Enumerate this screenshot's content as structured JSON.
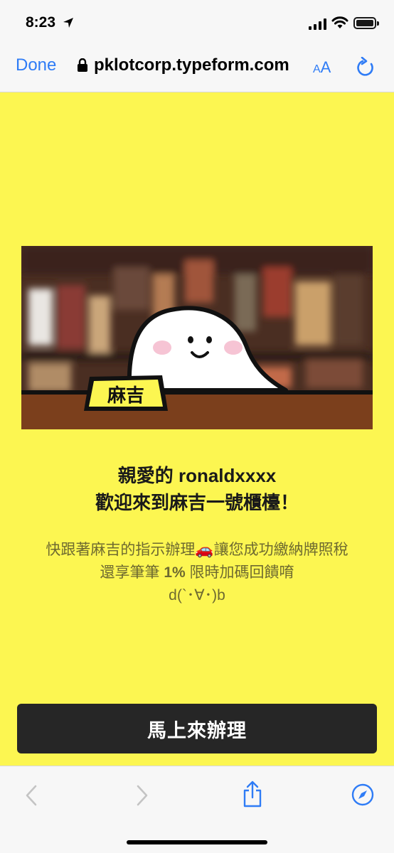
{
  "status_bar": {
    "time": "8:23"
  },
  "nav": {
    "done_label": "Done",
    "url": "pklotcorp.typeform.com",
    "aa_small": "A",
    "aa_big": "A"
  },
  "hero": {
    "nameplate": "麻吉"
  },
  "greeting": {
    "line1": "親愛的 ronaldxxxx",
    "line2": "歡迎來到麻吉一號櫃檯！"
  },
  "description": {
    "line1_part1": "快跟著麻吉的指示辦理",
    "line1_emoji": "🚗",
    "line1_part2": "讓您成功繳納牌照稅",
    "line2_part1": "還享筆筆 ",
    "line2_bold": "1%",
    "line2_part2": " 限時加碼回饋唷",
    "line3": "d(`･∀･)b"
  },
  "cta": {
    "label": "馬上來辦理"
  },
  "colors": {
    "accent": "#2f7cf6",
    "background": "#fcf651",
    "button": "#262626"
  },
  "toolbar": {
    "icons": [
      "back-icon",
      "forward-icon",
      "share-icon",
      "compass-icon"
    ]
  }
}
